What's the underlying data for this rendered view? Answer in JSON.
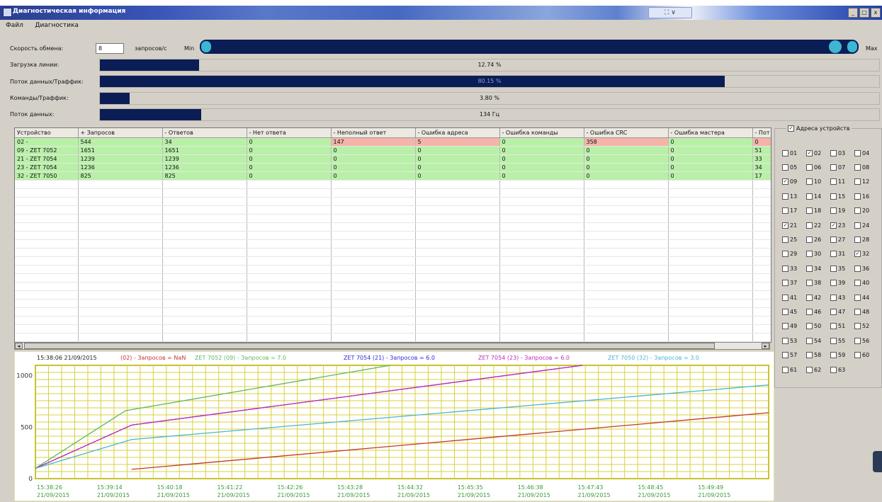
{
  "window": {
    "title": "Диагностическая информация",
    "mid_control": "⛶ ∨"
  },
  "menu": [
    "Файл",
    "Диагностика"
  ],
  "speed": {
    "label": "Скорость обмена:",
    "value": "8",
    "unit": "запросов/с",
    "min_label": "Min",
    "max_label": "Max",
    "level": 0.98
  },
  "meters": [
    {
      "label": "Загрузка линии:",
      "value": "12.74 %",
      "fill": 0.1274
    },
    {
      "label": "Поток данных/Траффик:",
      "value": "80.15 %",
      "fill": 0.8015
    },
    {
      "label": "Команды/Траффик:",
      "value": "3.80 %",
      "fill": 0.038
    },
    {
      "label": "Поток данных:",
      "value": "134 Гц",
      "fill": 0.13
    }
  ],
  "table": {
    "columns": [
      "Устройство",
      "+ Запросов",
      "- Ответов",
      "- Нет ответа",
      "- Неполный ответ",
      "- Ошибка адреса",
      "- Ошибка команды",
      "- Ошибка CRC",
      "- Ошибка мастера",
      "- Пот"
    ],
    "rows": [
      {
        "cells": [
          "02 -",
          "544",
          "34",
          "0",
          "147",
          "5",
          "0",
          "358",
          "0",
          "0"
        ],
        "errors": [
          4,
          5,
          7,
          9
        ]
      },
      {
        "cells": [
          "09 - ZET 7052",
          "1651",
          "1651",
          "0",
          "0",
          "0",
          "0",
          "0",
          "0",
          "51"
        ],
        "errors": []
      },
      {
        "cells": [
          "21 - ZET 7054",
          "1239",
          "1239",
          "0",
          "0",
          "0",
          "0",
          "0",
          "0",
          "33"
        ],
        "errors": []
      },
      {
        "cells": [
          "23 - ZET 7054",
          "1236",
          "1236",
          "0",
          "0",
          "0",
          "0",
          "0",
          "0",
          "34"
        ],
        "errors": []
      },
      {
        "cells": [
          "32 - ZET 7050",
          "825",
          "825",
          "0",
          "0",
          "0",
          "0",
          "0",
          "0",
          "17"
        ],
        "errors": []
      }
    ]
  },
  "addresses": {
    "title": "Адреса устройств",
    "title_checked": true,
    "items": [
      {
        "n": "01",
        "c": false
      },
      {
        "n": "02",
        "c": true
      },
      {
        "n": "03",
        "c": false
      },
      {
        "n": "04",
        "c": false
      },
      {
        "n": "05",
        "c": false
      },
      {
        "n": "06",
        "c": false
      },
      {
        "n": "07",
        "c": false
      },
      {
        "n": "08",
        "c": false
      },
      {
        "n": "09",
        "c": true
      },
      {
        "n": "10",
        "c": false
      },
      {
        "n": "11",
        "c": false
      },
      {
        "n": "12",
        "c": false
      },
      {
        "n": "13",
        "c": false
      },
      {
        "n": "14",
        "c": false
      },
      {
        "n": "15",
        "c": false
      },
      {
        "n": "16",
        "c": false
      },
      {
        "n": "17",
        "c": false
      },
      {
        "n": "18",
        "c": false
      },
      {
        "n": "19",
        "c": false
      },
      {
        "n": "20",
        "c": false
      },
      {
        "n": "21",
        "c": true
      },
      {
        "n": "22",
        "c": false
      },
      {
        "n": "23",
        "c": true
      },
      {
        "n": "24",
        "c": false
      },
      {
        "n": "25",
        "c": false
      },
      {
        "n": "26",
        "c": false
      },
      {
        "n": "27",
        "c": false
      },
      {
        "n": "28",
        "c": false
      },
      {
        "n": "29",
        "c": false
      },
      {
        "n": "30",
        "c": false
      },
      {
        "n": "31",
        "c": false
      },
      {
        "n": "32",
        "c": true
      },
      {
        "n": "33",
        "c": false
      },
      {
        "n": "34",
        "c": false
      },
      {
        "n": "35",
        "c": false
      },
      {
        "n": "36",
        "c": false
      },
      {
        "n": "37",
        "c": false
      },
      {
        "n": "38",
        "c": false
      },
      {
        "n": "39",
        "c": false
      },
      {
        "n": "40",
        "c": false
      },
      {
        "n": "41",
        "c": false
      },
      {
        "n": "42",
        "c": false
      },
      {
        "n": "43",
        "c": false
      },
      {
        "n": "44",
        "c": false
      },
      {
        "n": "45",
        "c": false
      },
      {
        "n": "46",
        "c": false
      },
      {
        "n": "47",
        "c": false
      },
      {
        "n": "48",
        "c": false
      },
      {
        "n": "49",
        "c": false
      },
      {
        "n": "50",
        "c": false
      },
      {
        "n": "51",
        "c": false
      },
      {
        "n": "52",
        "c": false
      },
      {
        "n": "53",
        "c": false
      },
      {
        "n": "54",
        "c": false
      },
      {
        "n": "55",
        "c": false
      },
      {
        "n": "56",
        "c": false
      },
      {
        "n": "57",
        "c": false
      },
      {
        "n": "58",
        "c": false
      },
      {
        "n": "59",
        "c": false
      },
      {
        "n": "60",
        "c": false
      },
      {
        "n": "61",
        "c": false
      },
      {
        "n": "62",
        "c": false
      },
      {
        "n": "63",
        "c": false
      }
    ]
  },
  "chart_data": {
    "type": "line",
    "title": "15:38:06 21/09/2015",
    "ylim": [
      0,
      1100
    ],
    "yticks": [
      0,
      500,
      1000
    ],
    "x_times": [
      "15:38:26",
      "15:39:14",
      "15:40:18",
      "15:41:22",
      "15:42:26",
      "15:43:28",
      "15:44:32",
      "15:45:35",
      "15:46:38",
      "15:47:43",
      "15:48:45",
      "15:49:49"
    ],
    "x_date": "21/09/2015",
    "xlim": [
      0,
      12.2
    ],
    "series": [
      {
        "name": "(02) - Запросов = NaN",
        "color": "#c0392b",
        "x": [
          1.6,
          12.2
        ],
        "y": [
          90,
          640
        ]
      },
      {
        "name": "ZET 7052 (09) - Запросов = 7.0",
        "color": "#5fb85f",
        "x": [
          0,
          1.5,
          5.9
        ],
        "y": [
          100,
          660,
          1100
        ]
      },
      {
        "name": "ZET 7054 (21) - Запросов = 6.0",
        "color": "#2a2ae0",
        "x": [
          0,
          1.6,
          9.1
        ],
        "y": [
          100,
          520,
          1100
        ]
      },
      {
        "name": "ZET 7054 (23) - Запросов = 6.0",
        "color": "#c02ac0",
        "x": [
          0,
          1.6,
          9.1
        ],
        "y": [
          100,
          520,
          1100
        ]
      },
      {
        "name": "ZET 7050 (32) - Запросов = 3.0",
        "color": "#49b6d2",
        "x": [
          0,
          1.6,
          12.2
        ],
        "y": [
          100,
          380,
          910
        ]
      }
    ]
  }
}
